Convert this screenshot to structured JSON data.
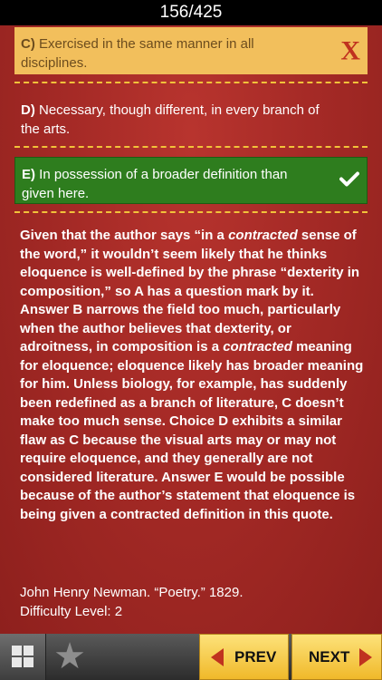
{
  "header": {
    "progress": "156/425"
  },
  "options": {
    "c": {
      "letter": "C)",
      "text": "Exercised in the same manner in all disciplines.",
      "status": "incorrect"
    },
    "d": {
      "letter": "D)",
      "text": "Necessary, though different, in every branch of the arts."
    },
    "e": {
      "letter": "E)",
      "text": "In possession of a broader definition than given here.",
      "status": "correct"
    }
  },
  "explanation": {
    "p1": "Given that the author says “in a ",
    "p1_em": "contracted",
    "p2": " sense of the word,” it wouldn’t seem likely that he thinks eloquence is well-defined by the phrase “dexterity in composition,” so A has a question mark by it. Answer B narrows the field too much, particularly when the author believes that dexterity, or adroitness, in composition is a ",
    "p2_em": "contracted",
    "p3": " meaning for eloquence; eloquence likely has broader meaning for him. Unless biology, for example, has suddenly been redefined as a branch of literature, C doesn’t make too much sense. Choice D exhibits a similar flaw as C because the visual arts may or may not require eloquence, and they generally are not considered literature. Answer E would be possible because of the author’s statement that eloquence is being given a contracted definition in this quote."
  },
  "source": {
    "citation": "John Henry Newman. “Poetry.” 1829.",
    "difficulty": "Difficulty Level: 2"
  },
  "toolbar": {
    "prev_label": "PREV",
    "next_label": "NEXT",
    "grid_icon": "grid-icon",
    "star_icon": "star-icon"
  },
  "colors": {
    "background": "#a52a26",
    "incorrect_bg": "#f2bf5c",
    "correct_bg": "#2e7d1e",
    "divider": "#f2c23a",
    "nav_button": "#f0b92a"
  }
}
